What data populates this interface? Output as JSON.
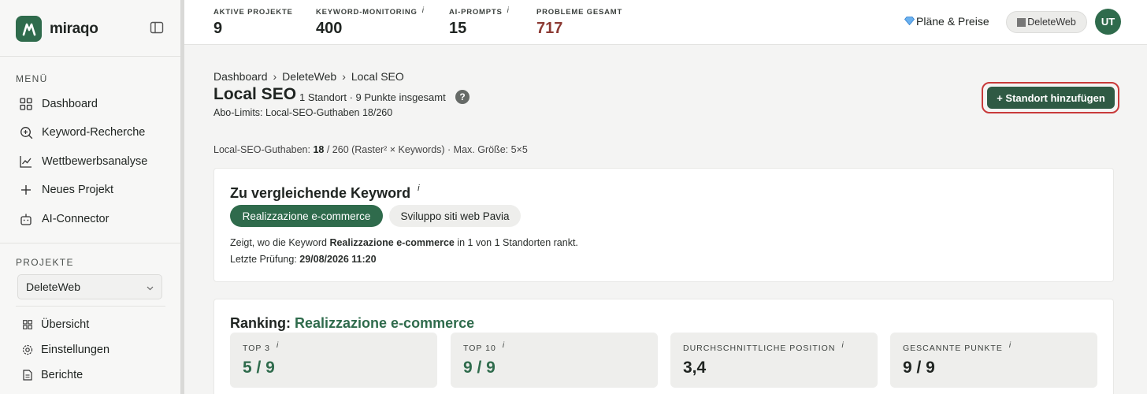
{
  "brand": {
    "name": "miraqo"
  },
  "sidebar": {
    "menu_label": "MENÜ",
    "items": [
      {
        "label": "Dashboard",
        "icon": "grid-icon"
      },
      {
        "label": "Keyword-Recherche",
        "icon": "search-plus-icon"
      },
      {
        "label": "Wettbewerbsanalyse",
        "icon": "line-chart-icon"
      },
      {
        "label": "Neues Projekt",
        "icon": "plus-icon"
      },
      {
        "label": "AI-Connector",
        "icon": "robot-icon"
      }
    ],
    "projects_label": "PROJEKTE",
    "project_select": "DeleteWeb",
    "project_items": [
      {
        "label": "Übersicht",
        "icon": "grid-small-icon"
      },
      {
        "label": "Einstellungen",
        "icon": "gear-icon"
      },
      {
        "label": "Berichte",
        "icon": "document-icon"
      }
    ]
  },
  "topbar": {
    "stats": [
      {
        "label": "AKTIVE PROJEKTE",
        "value": "9",
        "info": ""
      },
      {
        "label": "KEYWORD-MONITORING",
        "value": "400",
        "info": "i"
      },
      {
        "label": "AI-PROMPTS",
        "value": "15",
        "info": "i"
      },
      {
        "label": "PROBLEME GESAMT",
        "value": "717",
        "info": ""
      }
    ],
    "plans_label": "Pläne & Preise",
    "workspace_label": "DeleteWeb",
    "avatar_initials": "UT"
  },
  "page": {
    "breadcrumb": [
      "Dashboard",
      "DeleteWeb",
      "Local SEO"
    ],
    "breadcrumb_sep": "›",
    "title": "Local SEO",
    "meta": "1 Standort · 9 Punkte insgesamt",
    "help": "?",
    "abo_limits": "Abo-Limits: Local-SEO-Guthaben 18/260",
    "add_button": "+ Standort hinzufügen",
    "credits_prefix": "Local-SEO-Guthaben: ",
    "credits_used": "18",
    "credits_suffix": " / 260 (Raster² × Keywords) · Max. Größe: 5×5"
  },
  "compare": {
    "title": "Zu vergleichende Keyword",
    "info": "i",
    "chips": [
      "Realizzazione e-commerce",
      "Sviluppo siti web Pavia"
    ],
    "desc_prefix": "Zeigt, wo die Keyword ",
    "desc_keyword": "Realizzazione e-commerce",
    "desc_suffix": " in 1 von 1 Standorten rankt.",
    "lastcheck_prefix": "Letzte Prüfung: ",
    "lastcheck_value": "29/08/2026 11:20"
  },
  "ranking": {
    "title_prefix": "Ranking: ",
    "keyword": "Realizzazione e-commerce",
    "metrics": [
      {
        "label": "TOP 3",
        "value": "5 / 9"
      },
      {
        "label": "TOP 10",
        "value": "9 / 9"
      },
      {
        "label": "DURCHSCHNITTLICHE POSITION",
        "value": "3,4"
      },
      {
        "label": "GESCANNTE PUNKTE",
        "value": "9 / 9"
      }
    ],
    "info": "i"
  },
  "colors": {
    "brand_green": "#2f6b4c",
    "danger": "#8c3a33",
    "highlight_ring": "#c83a3a"
  }
}
